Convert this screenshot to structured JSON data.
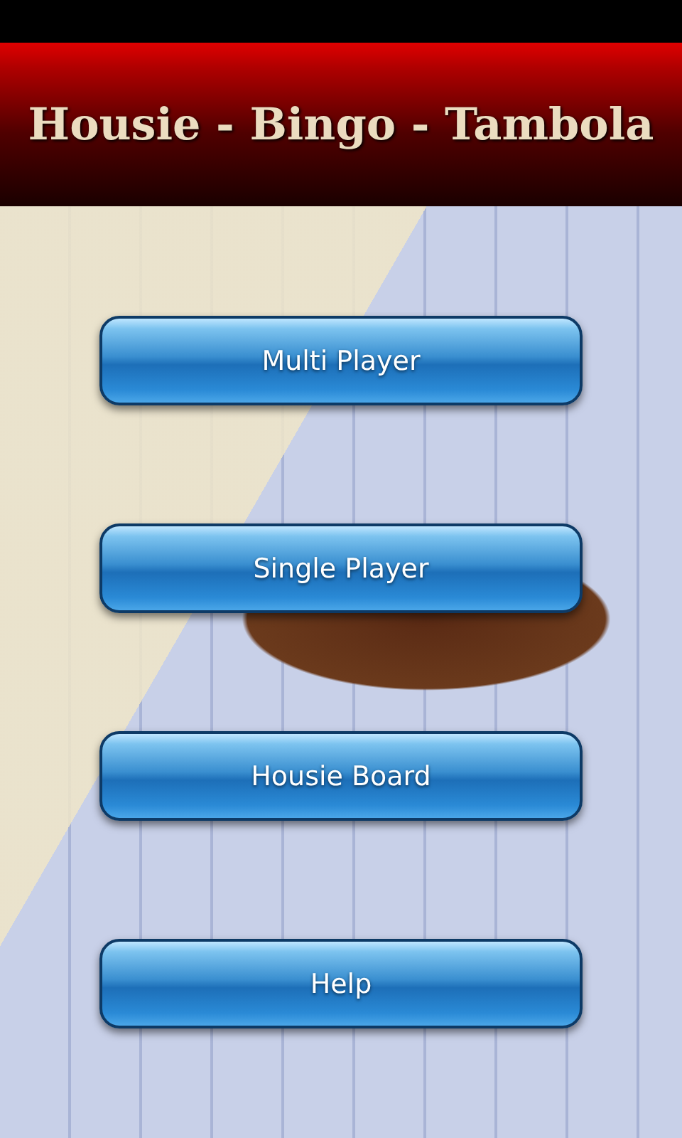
{
  "header": {
    "title": "Housie - Bingo - Tambola"
  },
  "menu": [
    {
      "label": "Multi Player"
    },
    {
      "label": "Single Player"
    },
    {
      "label": "Housie Board"
    },
    {
      "label": "Help"
    }
  ]
}
